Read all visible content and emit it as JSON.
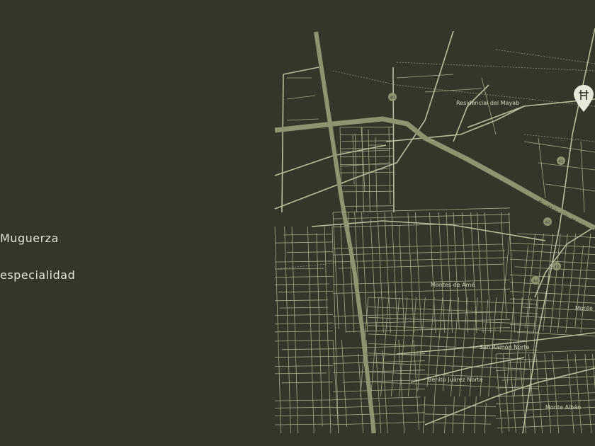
{
  "legend": {
    "items": [
      {
        "label": "Muguerza"
      },
      {
        "label": "especialidad"
      }
    ]
  },
  "map": {
    "neighborhoods": [
      {
        "name": "Residencial del Mayab"
      },
      {
        "name": "Montes de Amé"
      },
      {
        "name": "San Ramón Norte"
      },
      {
        "name": "Benito Juárez Norte"
      },
      {
        "name": "Monte Albán"
      },
      {
        "name": "Monte"
      }
    ],
    "roads": [
      {
        "name": "Periférico de Mérida"
      }
    ],
    "route_markers": [
      "40",
      "41",
      "42",
      "43",
      "44"
    ],
    "colors": {
      "background": "#33372a",
      "streets": "#b9bf9d",
      "main_roads": "#8c9470",
      "labels": "#d3d8bf"
    },
    "pin_icon": "location-pin-icon"
  }
}
